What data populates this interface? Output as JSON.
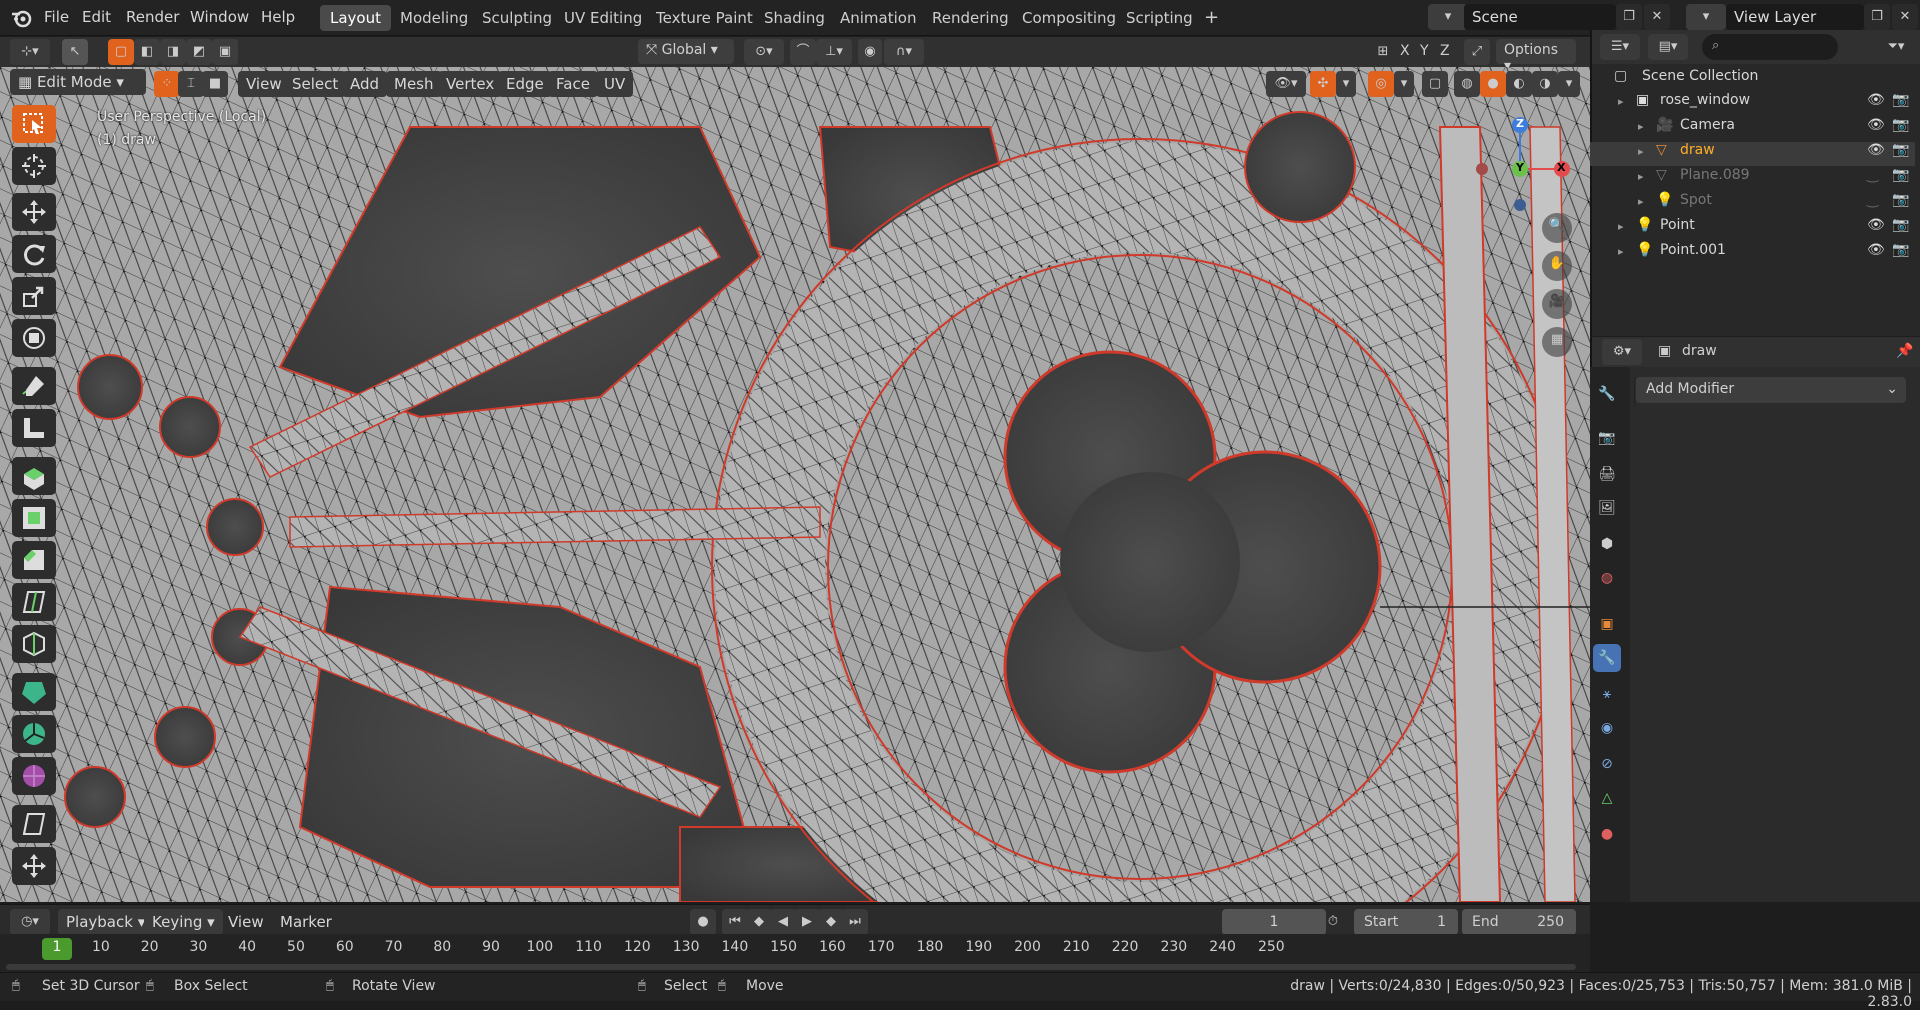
{
  "topbar": {
    "menus": [
      "File",
      "Edit",
      "Render",
      "Window",
      "Help"
    ],
    "workspaces": [
      "Layout",
      "Modeling",
      "Sculpting",
      "UV Editing",
      "Texture Paint",
      "Shading",
      "Animation",
      "Rendering",
      "Compositing",
      "Scripting"
    ],
    "active_workspace": "Layout",
    "add_workspace": "+",
    "scene": "Scene",
    "view_layer": "View Layer"
  },
  "tool_header": {
    "orientation": "Global",
    "options": "Options",
    "axes": [
      "X",
      "Y",
      "Z"
    ]
  },
  "viewport_header": {
    "mode": "Edit Mode",
    "menus": [
      "View",
      "Select",
      "Add",
      "Mesh",
      "Vertex",
      "Edge",
      "Face",
      "UV"
    ]
  },
  "viewport": {
    "overlay_line1": "User Perspective (Local)",
    "overlay_line2": "(1) draw",
    "gizmo": {
      "x": "X",
      "y": "Y",
      "z": "Z"
    }
  },
  "tools": [
    "select-box",
    "cursor",
    "move",
    "rotate",
    "scale",
    "transform",
    "annotate",
    "measure",
    "extrude",
    "inset",
    "bevel",
    "loop-cut",
    "knife",
    "poly-build",
    "spin",
    "smooth",
    "shrink-fatten",
    "shear"
  ],
  "outliner": {
    "root": "Scene Collection",
    "items": [
      {
        "label": "rose_window",
        "type": "collection",
        "indent": 1
      },
      {
        "label": "Camera",
        "type": "camera",
        "indent": 2
      },
      {
        "label": "draw",
        "type": "mesh",
        "indent": 2,
        "selected": true
      },
      {
        "label": "Plane.089",
        "type": "mesh",
        "indent": 2,
        "disabled": true
      },
      {
        "label": "Spot",
        "type": "light",
        "indent": 2,
        "disabled": true
      },
      {
        "label": "Point",
        "type": "light",
        "indent": 1
      },
      {
        "label": "Point.001",
        "type": "light",
        "indent": 1
      }
    ]
  },
  "properties": {
    "object_name": "draw",
    "add_modifier": "Add Modifier"
  },
  "timeline": {
    "menus": [
      "Playback",
      "Keying",
      "View",
      "Marker"
    ],
    "current_frame": "1",
    "start_label": "Start",
    "start": "1",
    "end_label": "End",
    "end": "250",
    "ticks": [
      "1",
      "10",
      "20",
      "30",
      "40",
      "50",
      "60",
      "70",
      "80",
      "90",
      "100",
      "110",
      "120",
      "130",
      "140",
      "150",
      "160",
      "170",
      "180",
      "190",
      "200",
      "210",
      "220",
      "230",
      "240",
      "250"
    ]
  },
  "statusbar": {
    "hint1": "Set 3D Cursor",
    "hint2": "Box Select",
    "hint3": "Rotate View",
    "hint4": "Select",
    "hint5": "Move",
    "stats": "draw | Verts:0/24,830 | Edges:0/50,923 | Faces:0/25,753 | Tris:50,757 | Mem: 381.0 MiB | 2.83.0"
  },
  "colors": {
    "accent": "#e0621d",
    "selected_row": "#334d80",
    "props_active": "#4772b3",
    "seam": "#d03a2a"
  }
}
